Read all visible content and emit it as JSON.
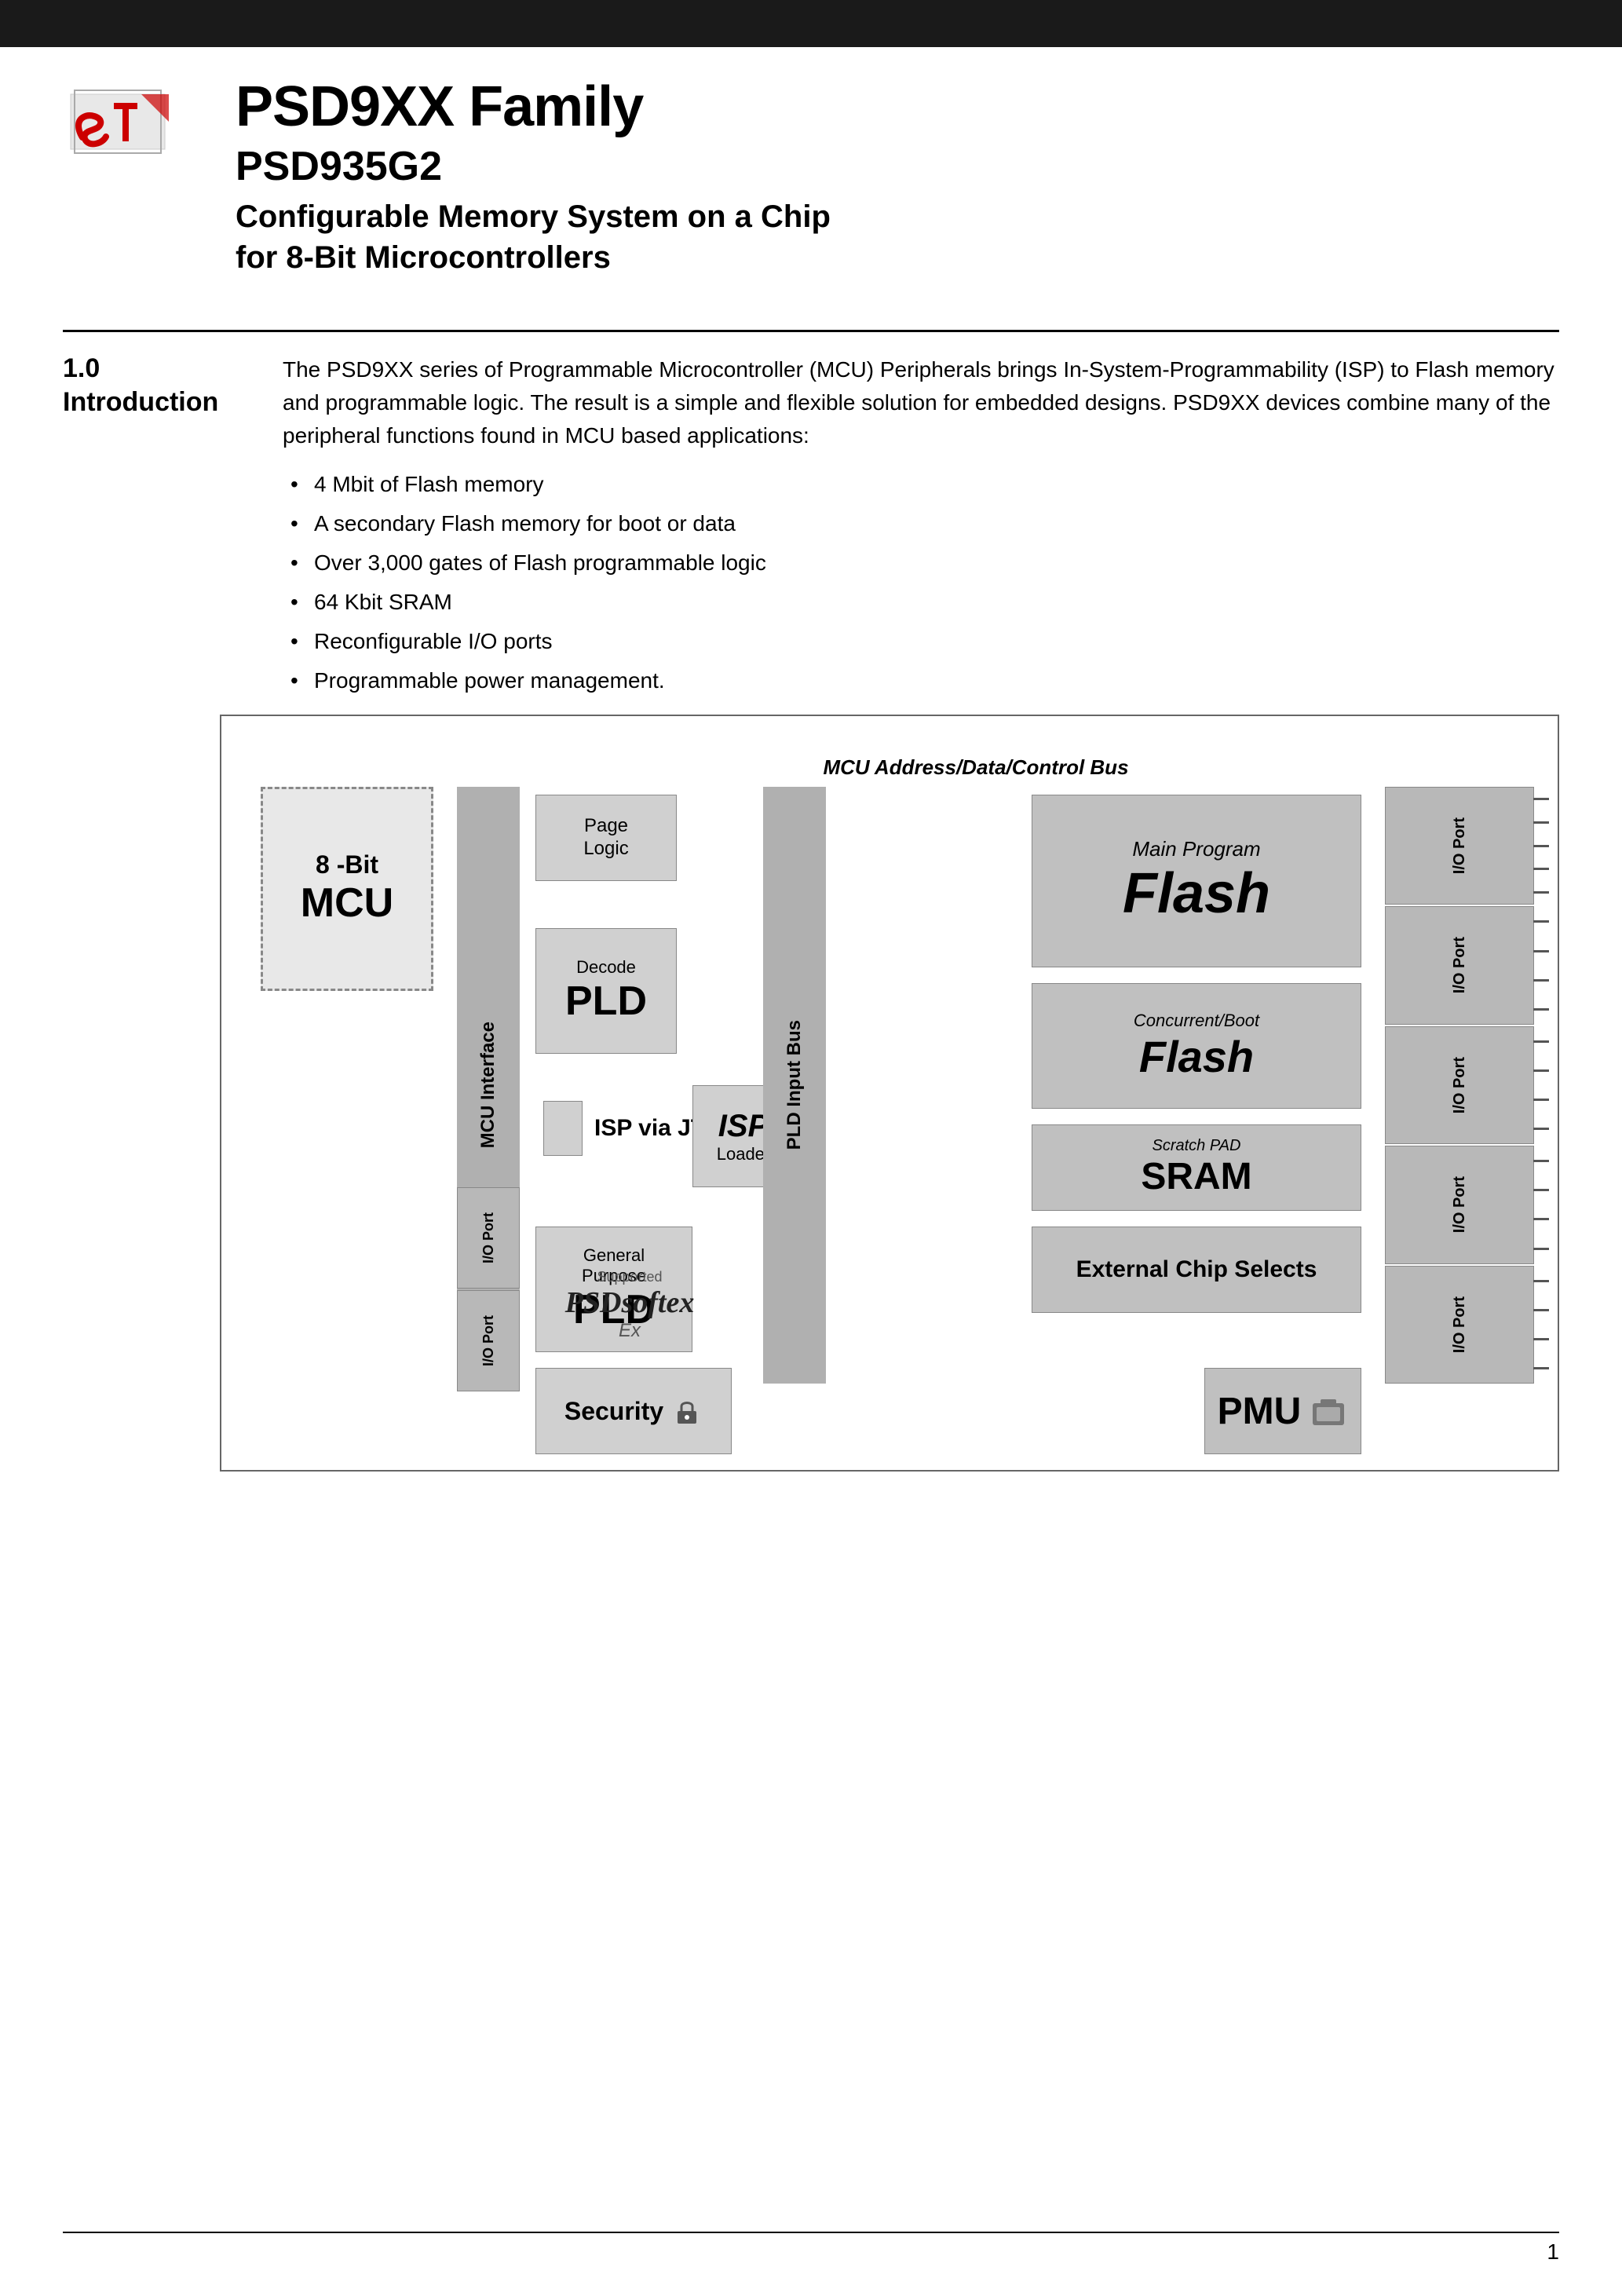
{
  "header": {
    "bar_bg": "#1a1a1a",
    "logo_alt": "ST Logo"
  },
  "title": {
    "family": "PSD9XX Family",
    "number": "PSD935G2",
    "description_line1": "Configurable Memory System on a Chip",
    "description_line2": "for 8-Bit Microcontrollers"
  },
  "section": {
    "number": "1.0",
    "name": "Introduction",
    "intro_paragraph": "The PSD9XX series of Programmable Microcontroller (MCU) Peripherals brings In-System-Programmability (ISP) to Flash memory and programmable logic. The result is a simple and flexible solution for embedded designs. PSD9XX devices combine many of the peripheral functions found in MCU based applications:",
    "bullets": [
      "4 Mbit of Flash memory",
      "A secondary Flash memory for boot or data",
      "Over 3,000 gates of Flash programmable logic",
      "64 Kbit SRAM",
      "Reconfigurable I/O ports",
      "Programmable power management."
    ]
  },
  "diagram": {
    "bus_label": "MCU Address/Data/Control Bus",
    "mcu": {
      "top_text": "8 -Bit",
      "main_text": "MCU"
    },
    "mcu_interface": "MCU Interface",
    "pld_input_bus": "PLD Input Bus",
    "page_logic": {
      "line1": "Page",
      "line2": "Logic"
    },
    "decode_pld": {
      "label": "Decode",
      "text": "PLD"
    },
    "main_flash": {
      "label": "Main Program",
      "text": "Flash"
    },
    "boot_flash": {
      "label": "Concurrent/Boot",
      "text": "Flash"
    },
    "sram": {
      "label": "Scratch PAD",
      "text": "SRAM"
    },
    "isp_jtag": "ISP via JTAG",
    "isp_loader": {
      "main": "ISP",
      "sub": "Loader"
    },
    "gp_pld": {
      "label1": "General",
      "label2": "Purpose",
      "text": "PLD"
    },
    "ext_chip_selects": "External Chip Selects",
    "security": "Security",
    "pmu": "PMU",
    "io_port_label": "I/O Port",
    "psd_supported": "Supported",
    "psd_logo": "PSDsoftex",
    "psd_ex": "Ex"
  },
  "page": {
    "number": "1"
  }
}
